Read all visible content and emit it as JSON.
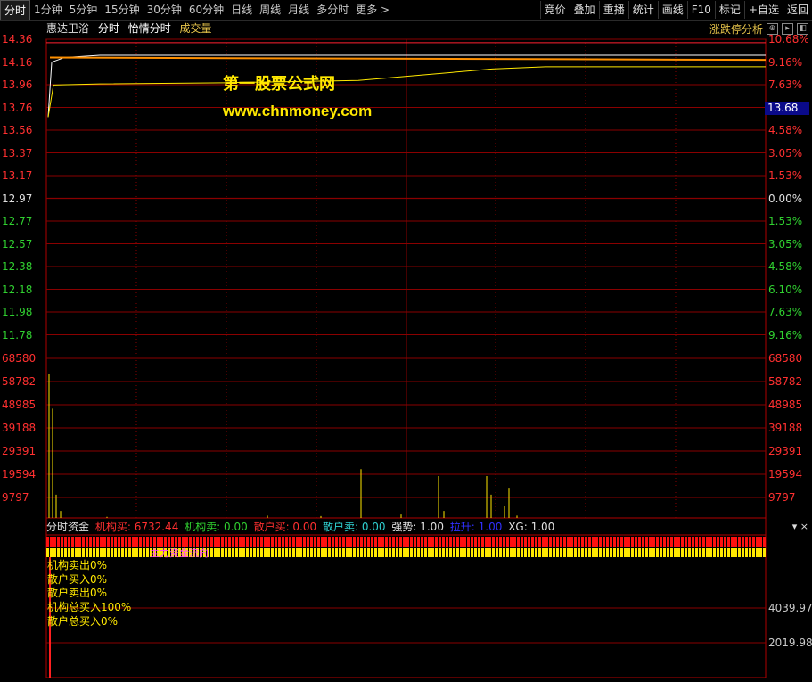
{
  "tabs": [
    "分时",
    "1分钟",
    "5分钟",
    "15分钟",
    "30分钟",
    "60分钟",
    "日线",
    "周线",
    "月线",
    "多分时",
    "更多 >"
  ],
  "right_buttons": [
    "竞价",
    "叠加",
    "重播",
    "统计",
    "画线",
    "F10",
    "标记",
    "+自选",
    "返回"
  ],
  "info": {
    "stock": "惠达卫浴",
    "mode": "分时",
    "indicator": "怡情分时",
    "volume": "成交量"
  },
  "analysis": {
    "label": "涨跌停分析",
    "controls": [
      "⊕",
      "▸",
      "◧"
    ]
  },
  "price_left": [
    "14.36",
    "14.16",
    "13.96",
    "13.76",
    "13.56",
    "13.37",
    "13.17",
    "12.97",
    "12.77",
    "12.57",
    "12.38",
    "12.18",
    "11.98",
    "11.78"
  ],
  "pct_right": [
    "10.68%",
    "9.16%",
    "7.63%",
    "6.10%",
    "4.58%",
    "3.05%",
    "1.53%",
    "0.00%",
    "1.53%",
    "3.05%",
    "4.58%",
    "6.10%",
    "7.63%",
    "9.16%"
  ],
  "vol_labels": [
    "68580",
    "58782",
    "48985",
    "39188",
    "29391",
    "19594",
    "9797"
  ],
  "current_price": "13.68",
  "watermark": {
    "line1": "第一股票公式网",
    "line2": "www.chnmoney.com"
  },
  "fund": {
    "title": "分时资金",
    "items": [
      {
        "text": "机构买: 6732.44",
        "color": "#ff3030"
      },
      {
        "text": "机构卖: 0.00",
        "color": "#30d030"
      },
      {
        "text": "散户买: 0.00",
        "color": "#ff3030"
      },
      {
        "text": "散户卖: 0.00",
        "color": "#30d0d0"
      },
      {
        "text": "强势: 1.00",
        "color": "#e0e0e0"
      },
      {
        "text": "拉升: 1.00",
        "color": "#2020ff"
      },
      {
        "text": "XG: 1.00",
        "color": "#e0e0e0"
      }
    ],
    "controls": "▾ ×",
    "lines": [
      "机构卖出0%",
      "散户买入0%",
      "散户卖出0%",
      "机构总买入100%",
      "散户总买入0%"
    ],
    "band_text": "主力资金流向",
    "right_labels": [
      "4039.97",
      "2019.98"
    ]
  },
  "chart_data": {
    "type": "line",
    "title": "",
    "series": [
      {
        "color": "#ffffff",
        "values": [
          13.68,
          14.16,
          14.2,
          14.22,
          14.22,
          14.22,
          14.22
        ]
      },
      {
        "color": "#ffe800",
        "values": [
          13.68,
          13.96,
          13.97,
          13.98,
          14.0,
          14.04,
          14.1,
          14.12,
          14.12,
          14.12
        ]
      }
    ],
    "ylim": [
      11.78,
      14.36
    ],
    "prev_close": "12.97",
    "volume_bars": [
      62000,
      47000,
      10000,
      3000,
      500,
      1000,
      800,
      21000,
      1500,
      18000,
      3000,
      18000,
      10000,
      5000,
      13000,
      1000
    ]
  }
}
